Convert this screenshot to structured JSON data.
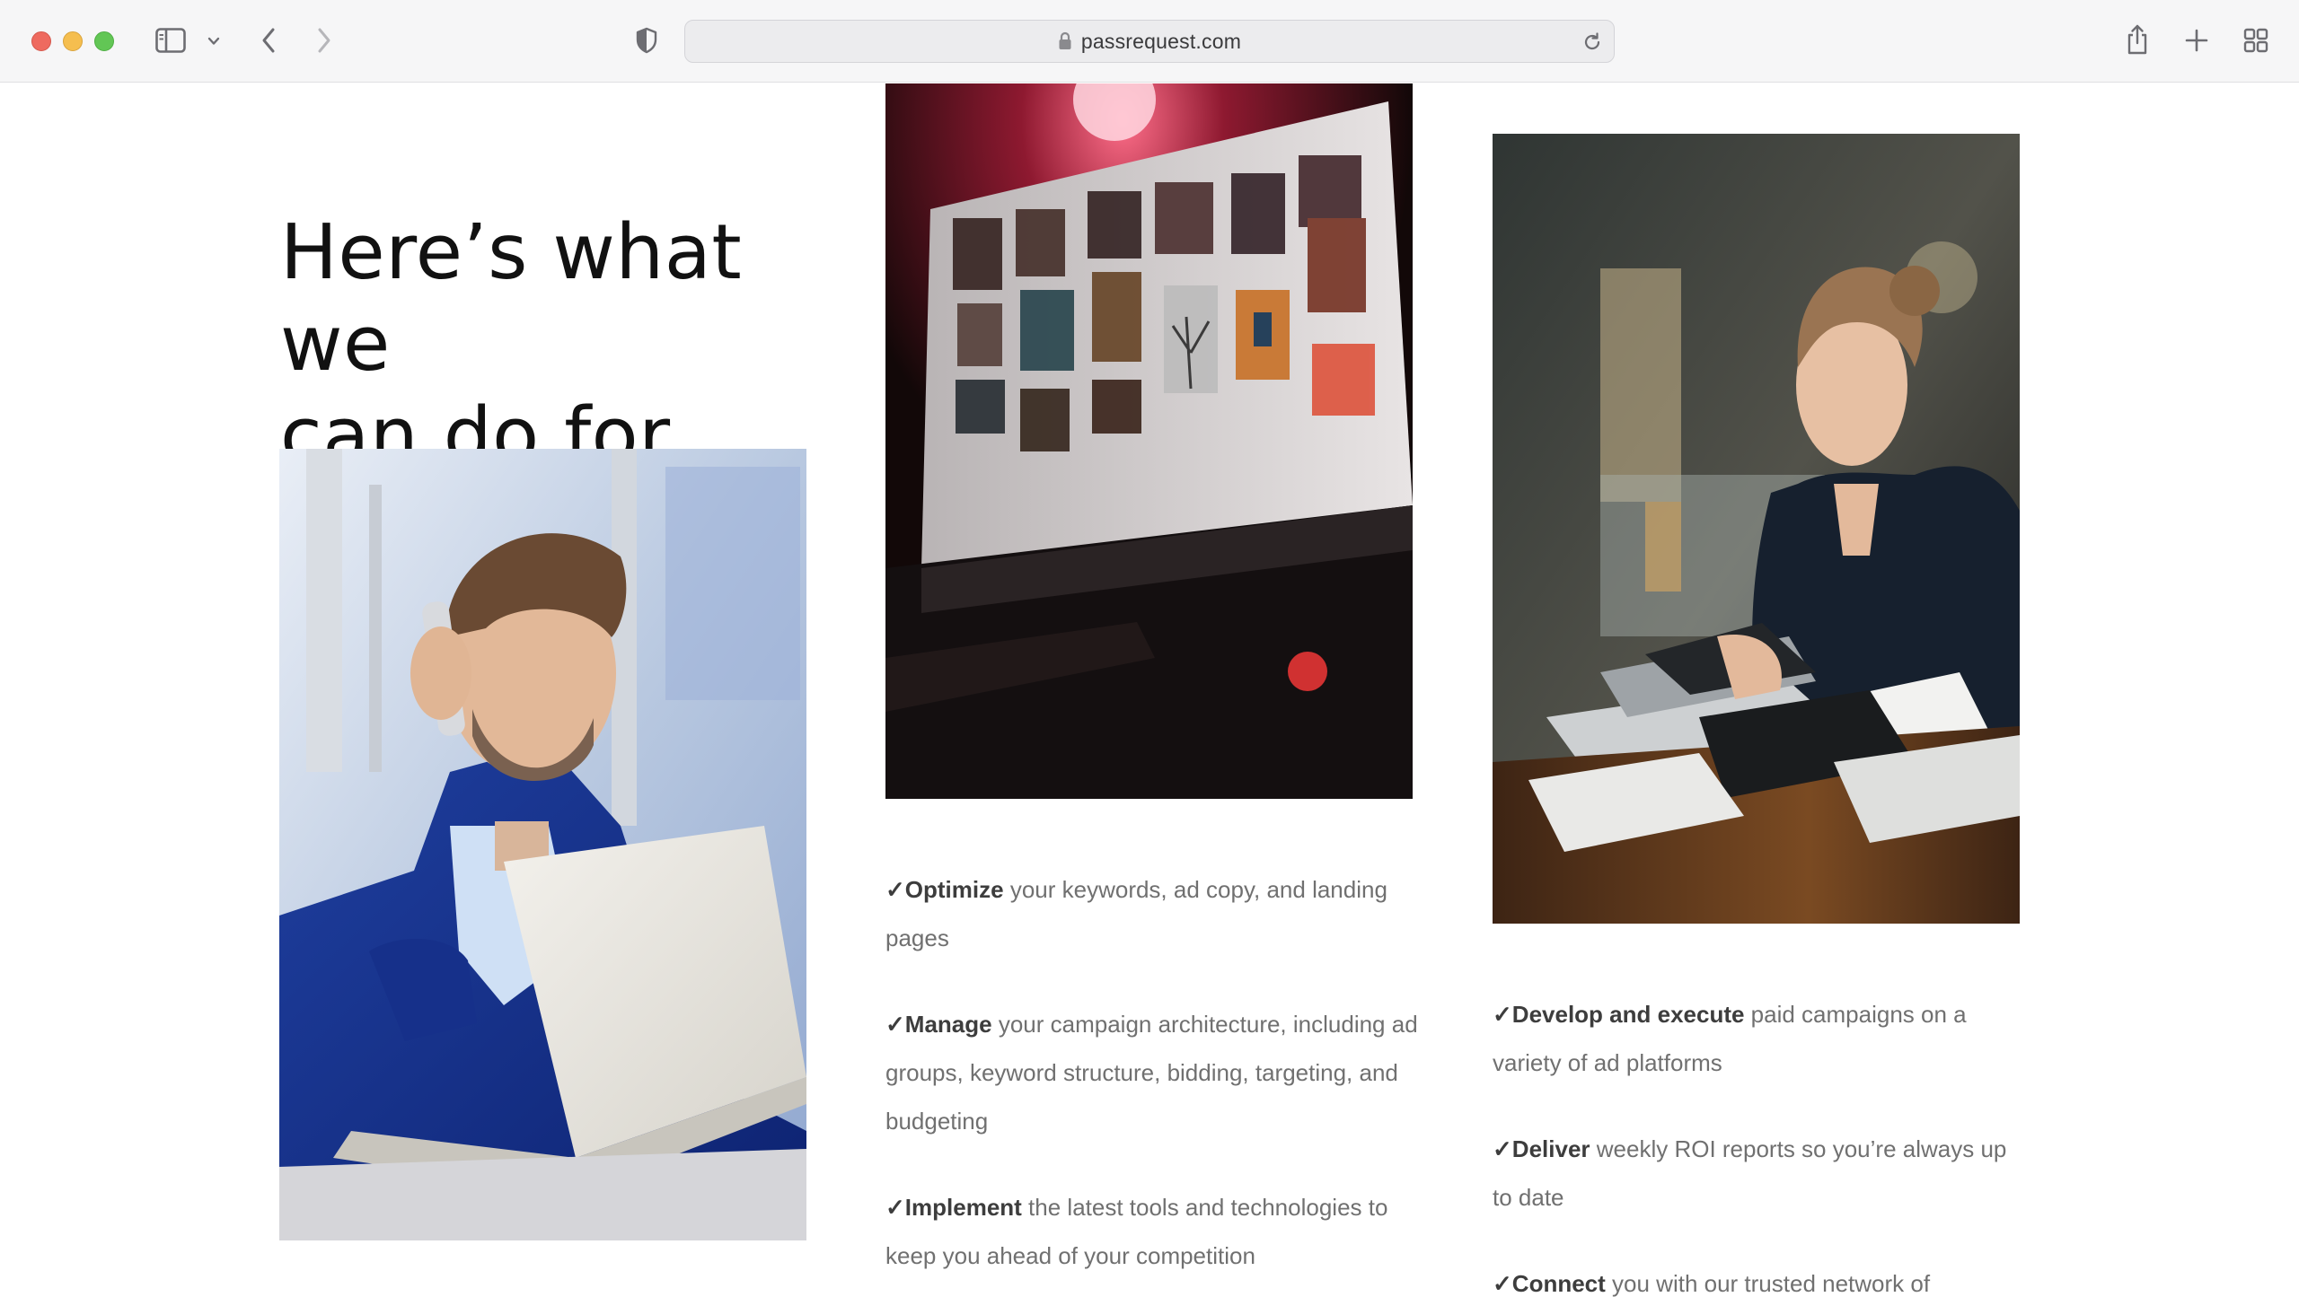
{
  "browser": {
    "url": "passrequest.com",
    "icons": {
      "sidebar": "sidebar-icon",
      "sidebar_menu": "chevron-down-icon",
      "back": "chevron-left-icon",
      "forward": "chevron-right-icon",
      "privacy": "shield-icon",
      "lock": "lock-icon",
      "reload": "reload-icon",
      "share": "share-icon",
      "new_tab": "plus-icon",
      "tab_overview": "grid-icon"
    },
    "traffic_light_colors": [
      "#ee6a5f",
      "#f5be4f",
      "#62c655"
    ]
  },
  "page": {
    "headline_line1": "Here’s what we",
    "headline_line2": "can do for you.",
    "photos": {
      "left": "man-on-phone-with-laptop-photo",
      "middle": "laptop-screen-gallery-photo",
      "right": "woman-writing-at-laptop-photo"
    },
    "check_mark": "✓",
    "features_middle": [
      {
        "strong": "Optimize",
        "rest": " your keywords, ad copy, and landing pages"
      },
      {
        "strong": "Manage",
        "rest": " your campaign architecture, including ad groups, keyword structure, bidding, targeting, and budgeting"
      },
      {
        "strong": "Implement",
        "rest": " the latest tools and technologies to keep you ahead of your competition"
      }
    ],
    "features_right": [
      {
        "strong": "Develop and execute",
        "rest": " paid campaigns on a variety of ad platforms"
      },
      {
        "strong": "Deliver",
        "rest": " weekly ROI reports so you’re always up to date"
      },
      {
        "strong": "Connect",
        "rest": " you with our trusted network of"
      }
    ],
    "colors": {
      "headline": "#111111",
      "feature_text": "#707070",
      "feature_strong": "#3d3d3d"
    }
  }
}
